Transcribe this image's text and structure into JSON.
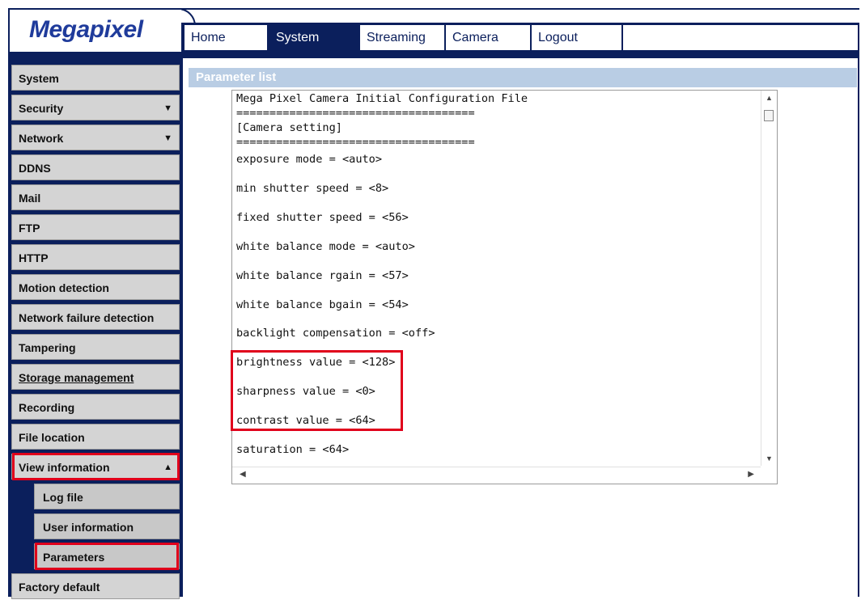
{
  "app": {
    "logo": "Megapixel"
  },
  "nav": {
    "tabs": [
      {
        "label": "Home"
      },
      {
        "label": "System"
      },
      {
        "label": "Streaming"
      },
      {
        "label": "Camera"
      },
      {
        "label": "Logout"
      },
      {
        "label": ""
      }
    ],
    "active_tab": "System"
  },
  "sidebar": {
    "items": [
      {
        "label": "System"
      },
      {
        "label": "Security",
        "arrow": "▼"
      },
      {
        "label": "Network",
        "arrow": "▼"
      },
      {
        "label": "DDNS"
      },
      {
        "label": "Mail"
      },
      {
        "label": "FTP"
      },
      {
        "label": "HTTP"
      },
      {
        "label": "Motion detection"
      },
      {
        "label": "Network failure detection"
      },
      {
        "label": "Tampering"
      },
      {
        "label": "Storage management"
      },
      {
        "label": "Recording"
      },
      {
        "label": "File location"
      },
      {
        "label": "View information",
        "arrow": "▲"
      },
      {
        "label": "Log file"
      },
      {
        "label": "User information"
      },
      {
        "label": "Parameters"
      },
      {
        "label": "Factory default"
      }
    ]
  },
  "main": {
    "section_title": "Parameter list",
    "lines": [
      "Mega Pixel Camera Initial Configuration File",
      "====================================",
      "[Camera setting]",
      "====================================",
      "exposure mode = <auto>",
      "min shutter speed = <8>",
      "fixed shutter speed = <56>",
      "white balance mode = <auto>",
      "white balance rgain = <57>",
      "white balance bgain = <54>",
      "backlight compensation = <off>",
      "brightness value = <128>",
      "sharpness value = <0>",
      "contrast value = <64>",
      "saturation = <64>"
    ]
  },
  "colors": {
    "navy": "#0b1f5c",
    "logo_blue": "#1f3b9b",
    "highlight": "#e0001b",
    "header_bg": "#b9cde4"
  }
}
